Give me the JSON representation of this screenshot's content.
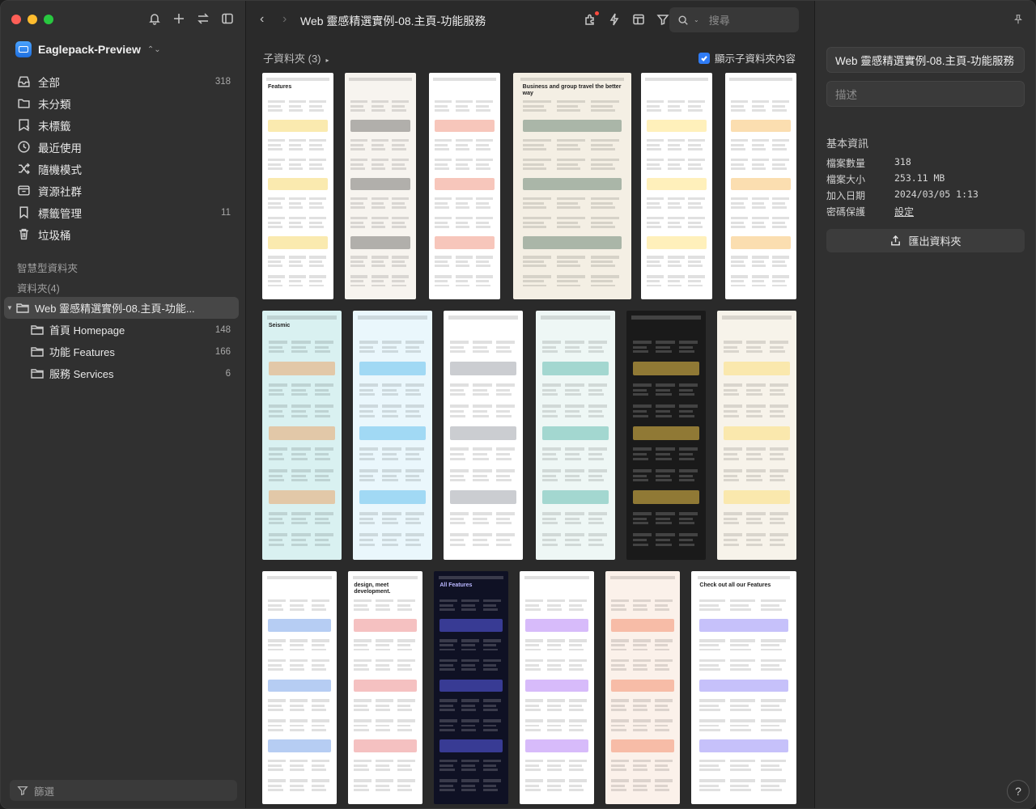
{
  "sidebar": {
    "library_name": "Eaglepack-Preview",
    "nav": [
      {
        "label": "全部",
        "count": "318",
        "icon": "inbox-icon"
      },
      {
        "label": "未分類",
        "count": "",
        "icon": "uncategorized-folder-icon"
      },
      {
        "label": "未標籤",
        "count": "",
        "icon": "untagged-icon"
      },
      {
        "label": "最近使用",
        "count": "",
        "icon": "clock-icon"
      },
      {
        "label": "隨機模式",
        "count": "",
        "icon": "shuffle-icon"
      },
      {
        "label": "資源社群",
        "count": "",
        "icon": "community-icon"
      },
      {
        "label": "標籤管理",
        "count": "11",
        "icon": "bookmark-icon"
      },
      {
        "label": "垃圾桶",
        "count": "",
        "icon": "trash-icon"
      }
    ],
    "smart_folders_label": "智慧型資料夾",
    "folders_label": "資料夾(4)",
    "folders": [
      {
        "label": "Web 靈感精選實例-08.主頁-功能...",
        "count": "",
        "selected": true,
        "child": false
      },
      {
        "label": "首頁 Homepage",
        "count": "148",
        "selected": false,
        "child": true
      },
      {
        "label": "功能 Features",
        "count": "166",
        "selected": false,
        "child": true
      },
      {
        "label": "服務 Services",
        "count": "6",
        "selected": false,
        "child": true
      }
    ],
    "filter_label": "篩選"
  },
  "toolbar": {
    "title": "Web 靈感精選實例-08.主頁-功能服務",
    "search_placeholder": "搜尋"
  },
  "main": {
    "subfolder_label": "子資料夾 (3)",
    "show_subfolder_label": "顯示子資料夾內容"
  },
  "inspector": {
    "title_value": "Web 靈感精選實例-08.主頁-功能服務",
    "desc_placeholder": "描述",
    "info_title": "基本資訊",
    "info": [
      {
        "k": "檔案數量",
        "v": "318",
        "link": false
      },
      {
        "k": "檔案大小",
        "v": "253.11 MB",
        "link": false
      },
      {
        "k": "加入日期",
        "v": "2024/03/05 1:13",
        "link": false
      },
      {
        "k": "密碼保護",
        "v": "設定",
        "link": true
      }
    ],
    "export_label": "匯出資料夾",
    "help_label": "?"
  },
  "thumbnails": [
    {
      "name": "thumb-features-light",
      "bg": "#ffffff",
      "accent": "#f0c419",
      "text": "Features"
    },
    {
      "name": "thumb-decentralized",
      "bg": "#f7f4ef",
      "accent": "#2d2d2d",
      "text": ""
    },
    {
      "name": "thumb-team-manager",
      "bg": "#ffffff",
      "accent": "#e85d3b",
      "text": ""
    },
    {
      "name": "thumb-business-travel",
      "bg": "#f4efe4",
      "accent": "#1f4d3a",
      "text": "Business and group travel the better way"
    },
    {
      "name": "thumb-co-create",
      "bg": "#ffffff",
      "accent": "#ffd43b",
      "text": ""
    },
    {
      "name": "thumb-flexible-features",
      "bg": "#ffffff",
      "accent": "#f4a11c",
      "text": ""
    },
    {
      "name": "thumb-seismic",
      "bg": "#d9f1f1",
      "accent": "#f47b20",
      "text": "Seismic"
    },
    {
      "name": "thumb-features-that-make",
      "bg": "#eaf7fc",
      "accent": "#1aa0e6",
      "text": ""
    },
    {
      "name": "thumb-secure-productivity",
      "bg": "#ffffff",
      "accent": "#6b6f7a",
      "text": ""
    },
    {
      "name": "thumb-frameworks",
      "bg": "#eef7f5",
      "accent": "#169c8b",
      "text": ""
    },
    {
      "name": "thumb-keep-a-finger",
      "bg": "#1a1a1a",
      "accent": "#f2c94c",
      "text": ""
    },
    {
      "name": "thumb-start-collaborating",
      "bg": "#f7f3ea",
      "accent": "#ffd43b",
      "text": ""
    },
    {
      "name": "thumb-streamline",
      "bg": "#ffffff",
      "accent": "#2f6fde",
      "text": ""
    },
    {
      "name": "thumb-design-meet-dev",
      "bg": "#ffffff",
      "accent": "#e34c4c",
      "text": "design, meet development."
    },
    {
      "name": "thumb-all-features-dark",
      "bg": "#0f1124",
      "accent": "#5b5ef0",
      "text": "All Features"
    },
    {
      "name": "thumb-purple-gradient",
      "bg": "#ffffff",
      "accent": "#8b3cf0",
      "text": ""
    },
    {
      "name": "thumb-handling-knowledge",
      "bg": "#fbf1ea",
      "accent": "#f05a2a",
      "text": ""
    },
    {
      "name": "thumb-check-all-features",
      "bg": "#ffffff",
      "accent": "#5b4cf0",
      "text": "Check out all our Features"
    }
  ]
}
